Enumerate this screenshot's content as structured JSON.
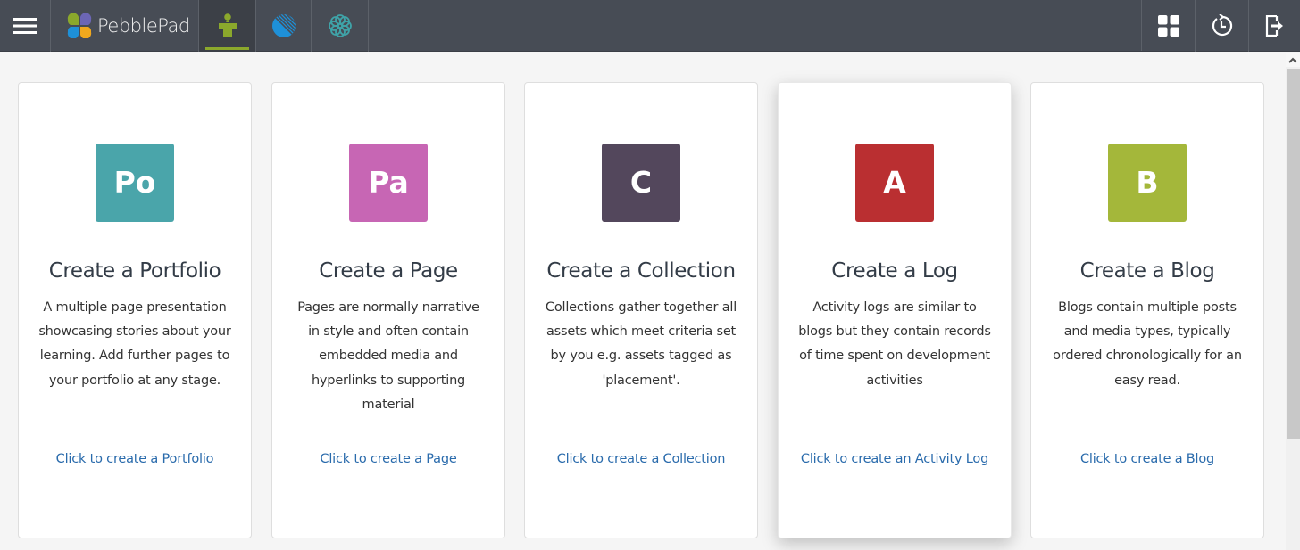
{
  "app": {
    "brand": "PebblePad"
  },
  "topbar": {
    "menu_icon": "hamburger-menu-icon",
    "apps": [
      {
        "name": "pebblepad-personal-icon",
        "active": true
      },
      {
        "name": "atlas-icon",
        "active": false
      },
      {
        "name": "flower-icon",
        "active": false
      }
    ],
    "right_icons": [
      "grid-icon",
      "history-icon",
      "logout-icon"
    ]
  },
  "colors": {
    "topbar": "#474c55",
    "accent": "#8ba82c",
    "link": "#2a6bac",
    "portfolio": "#4aa5aa",
    "page": "#c766b4",
    "collection": "#53475c",
    "log": "#ba2f31",
    "blog": "#a4b73a"
  },
  "cards": [
    {
      "abbr": "Po",
      "title": "Create a Portfolio",
      "description": "A multiple page presentation showcasing stories about your learning. Add further pages to your portfolio at any stage.",
      "link": "Click to create a Portfolio"
    },
    {
      "abbr": "Pa",
      "title": "Create a Page",
      "description": "Pages are normally narrative in style and often contain embedded media and hyperlinks to supporting material",
      "link": "Click to create a Page"
    },
    {
      "abbr": "C",
      "title": "Create a Collection",
      "description": "Collections gather together all assets which meet criteria set by you e.g. assets tagged as 'placement'.",
      "link": "Click to create a Collection"
    },
    {
      "abbr": "A",
      "title": "Create a Log",
      "description": "Activity logs are similar to blogs but they contain records of time spent on development activities",
      "link": "Click to create an Activity Log"
    },
    {
      "abbr": "B",
      "title": "Create a Blog",
      "description": "Blogs contain multiple posts and media types, typically ordered chronologically for an easy read.",
      "link": "Click to create a Blog"
    }
  ]
}
